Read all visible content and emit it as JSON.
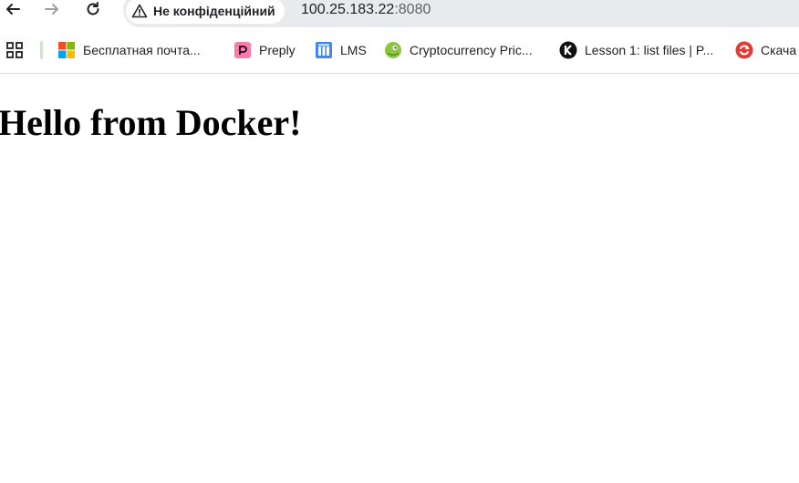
{
  "browser": {
    "security_label": "Не конфіденційний",
    "url_host": "100.25.183.22",
    "url_port": ":8080"
  },
  "bookmarks": [
    {
      "label": "Бесплатная почта...",
      "icon": "microsoft-icon"
    },
    {
      "label": "Preply",
      "icon": "preply-icon"
    },
    {
      "label": "LMS",
      "icon": "lms-icon"
    },
    {
      "label": "Cryptocurrency Pric...",
      "icon": "coingecko-icon"
    },
    {
      "label": "Lesson 1: list files | P...",
      "icon": "k-icon"
    },
    {
      "label": "Скача",
      "icon": "download-icon"
    }
  ],
  "page": {
    "heading": "Hello from Docker!"
  },
  "colors": {
    "omnibox_bg": "#e8eaed",
    "text": "#202124",
    "muted": "#5f6368",
    "separator": "#cde6c9"
  }
}
